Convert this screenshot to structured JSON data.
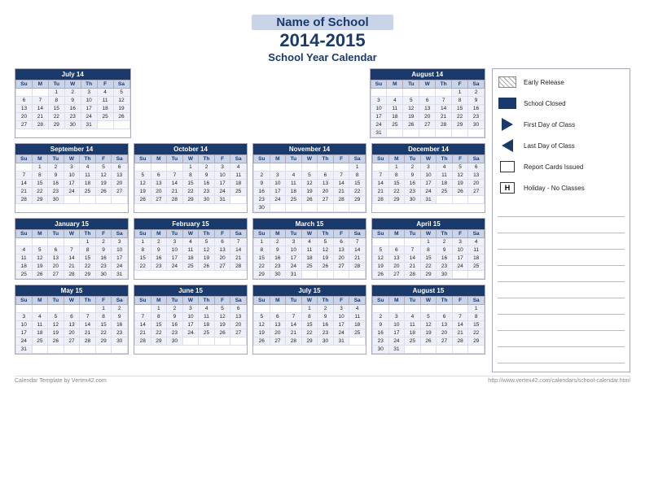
{
  "header": {
    "school_name": "Name of School",
    "year": "2014-2015",
    "subtitle": "School Year Calendar"
  },
  "legend": {
    "items": [
      {
        "id": "early-release",
        "label": "Early Release",
        "icon": "hatch"
      },
      {
        "id": "school-closed",
        "label": "School Closed",
        "icon": "solid"
      },
      {
        "id": "first-day",
        "label": "First Day of Class",
        "icon": "triangle-right"
      },
      {
        "id": "last-day",
        "label": "Last Day of Class",
        "icon": "triangle-left"
      },
      {
        "id": "report-cards",
        "label": "Report Cards Issued",
        "icon": "outline-box"
      },
      {
        "id": "holiday",
        "label": "Holiday - No Classes",
        "icon": "h-box"
      }
    ]
  },
  "footer": {
    "left": "Calendar Template by Vertex42.com",
    "right": "http://www.vertex42.com/calendars/school-calendar.html"
  },
  "months": [
    {
      "name": "July 14",
      "headers": [
        "Su",
        "M",
        "Tu",
        "W",
        "Th",
        "F",
        "Sa"
      ],
      "rows": [
        [
          "",
          "",
          "1",
          "2",
          "3",
          "4",
          "5"
        ],
        [
          "6",
          "7",
          "8",
          "9",
          "10",
          "11",
          "12"
        ],
        [
          "13",
          "14",
          "15",
          "16",
          "17",
          "18",
          "19"
        ],
        [
          "20",
          "21",
          "22",
          "23",
          "24",
          "25",
          "26"
        ],
        [
          "27",
          "28",
          "29",
          "30",
          "31",
          "",
          ""
        ]
      ]
    },
    {
      "name": "August 14",
      "headers": [
        "Su",
        "M",
        "Tu",
        "W",
        "Th",
        "F",
        "Sa"
      ],
      "rows": [
        [
          "",
          "",
          "",
          "",
          "",
          "1",
          "2"
        ],
        [
          "3",
          "4",
          "5",
          "6",
          "7",
          "8",
          "9"
        ],
        [
          "10",
          "11",
          "12",
          "13",
          "14",
          "15",
          "16"
        ],
        [
          "17",
          "18",
          "19",
          "20",
          "21",
          "22",
          "23"
        ],
        [
          "24",
          "25",
          "26",
          "27",
          "28",
          "29",
          "30"
        ],
        [
          "31",
          "",
          "",
          "",
          "",
          "",
          ""
        ]
      ]
    },
    {
      "name": "September 14",
      "headers": [
        "Su",
        "M",
        "Tu",
        "W",
        "Th",
        "F",
        "Sa"
      ],
      "rows": [
        [
          "",
          "1",
          "2",
          "3",
          "4",
          "5",
          "6"
        ],
        [
          "7",
          "8",
          "9",
          "10",
          "11",
          "12",
          "13"
        ],
        [
          "14",
          "15",
          "16",
          "17",
          "18",
          "19",
          "20"
        ],
        [
          "21",
          "22",
          "23",
          "24",
          "25",
          "26",
          "27"
        ],
        [
          "28",
          "29",
          "30",
          "",
          "",
          "",
          ""
        ]
      ]
    },
    {
      "name": "October 14",
      "headers": [
        "Su",
        "M",
        "Tu",
        "W",
        "Th",
        "F",
        "Sa"
      ],
      "rows": [
        [
          "",
          "",
          "",
          "1",
          "2",
          "3",
          "4"
        ],
        [
          "5",
          "6",
          "7",
          "8",
          "9",
          "10",
          "11"
        ],
        [
          "12",
          "13",
          "14",
          "15",
          "16",
          "17",
          "18"
        ],
        [
          "19",
          "20",
          "21",
          "22",
          "23",
          "24",
          "25"
        ],
        [
          "26",
          "27",
          "28",
          "29",
          "30",
          "31",
          ""
        ]
      ]
    },
    {
      "name": "November 14",
      "headers": [
        "Su",
        "M",
        "Tu",
        "W",
        "Th",
        "F",
        "Sa"
      ],
      "rows": [
        [
          "",
          "",
          "",
          "",
          "",
          "",
          "1"
        ],
        [
          "2",
          "3",
          "4",
          "5",
          "6",
          "7",
          "8"
        ],
        [
          "9",
          "10",
          "11",
          "12",
          "13",
          "14",
          "15"
        ],
        [
          "16",
          "17",
          "18",
          "19",
          "20",
          "21",
          "22"
        ],
        [
          "23",
          "24",
          "25",
          "26",
          "27",
          "28",
          "29"
        ],
        [
          "30",
          "",
          "",
          "",
          "",
          "",
          ""
        ]
      ]
    },
    {
      "name": "December 14",
      "headers": [
        "Su",
        "M",
        "Tu",
        "W",
        "Th",
        "F",
        "Sa"
      ],
      "rows": [
        [
          "",
          "1",
          "2",
          "3",
          "4",
          "5",
          "6"
        ],
        [
          "7",
          "8",
          "9",
          "10",
          "11",
          "12",
          "13"
        ],
        [
          "14",
          "15",
          "16",
          "17",
          "18",
          "19",
          "20"
        ],
        [
          "21",
          "22",
          "23",
          "24",
          "25",
          "26",
          "27"
        ],
        [
          "28",
          "29",
          "30",
          "31",
          "",
          "",
          ""
        ]
      ]
    },
    {
      "name": "January 15",
      "headers": [
        "Su",
        "M",
        "Tu",
        "W",
        "Th",
        "F",
        "Sa"
      ],
      "rows": [
        [
          "",
          "",
          "",
          "",
          "1",
          "2",
          "3"
        ],
        [
          "4",
          "5",
          "6",
          "7",
          "8",
          "9",
          "10"
        ],
        [
          "11",
          "12",
          "13",
          "14",
          "15",
          "16",
          "17"
        ],
        [
          "18",
          "19",
          "20",
          "21",
          "22",
          "23",
          "24"
        ],
        [
          "25",
          "26",
          "27",
          "28",
          "29",
          "30",
          "31"
        ]
      ]
    },
    {
      "name": "February 15",
      "headers": [
        "Su",
        "M",
        "Tu",
        "W",
        "Th",
        "F",
        "Sa"
      ],
      "rows": [
        [
          "1",
          "2",
          "3",
          "4",
          "5",
          "6",
          "7"
        ],
        [
          "8",
          "9",
          "10",
          "11",
          "12",
          "13",
          "14"
        ],
        [
          "15",
          "16",
          "17",
          "18",
          "19",
          "20",
          "21"
        ],
        [
          "22",
          "23",
          "24",
          "25",
          "26",
          "27",
          "28"
        ]
      ]
    },
    {
      "name": "March 15",
      "headers": [
        "Su",
        "M",
        "Tu",
        "W",
        "Th",
        "F",
        "Sa"
      ],
      "rows": [
        [
          "1",
          "2",
          "3",
          "4",
          "5",
          "6",
          "7"
        ],
        [
          "8",
          "9",
          "10",
          "11",
          "12",
          "13",
          "14"
        ],
        [
          "15",
          "16",
          "17",
          "18",
          "19",
          "20",
          "21"
        ],
        [
          "22",
          "23",
          "24",
          "25",
          "26",
          "27",
          "28"
        ],
        [
          "29",
          "30",
          "31",
          "",
          "",
          "",
          ""
        ]
      ]
    },
    {
      "name": "April 15",
      "headers": [
        "Su",
        "M",
        "Tu",
        "W",
        "Th",
        "F",
        "Sa"
      ],
      "rows": [
        [
          "",
          "",
          "",
          "1",
          "2",
          "3",
          "4"
        ],
        [
          "5",
          "6",
          "7",
          "8",
          "9",
          "10",
          "11"
        ],
        [
          "12",
          "13",
          "14",
          "15",
          "16",
          "17",
          "18"
        ],
        [
          "19",
          "20",
          "21",
          "22",
          "23",
          "24",
          "25"
        ],
        [
          "26",
          "27",
          "28",
          "29",
          "30",
          "",
          ""
        ]
      ]
    },
    {
      "name": "May 15",
      "headers": [
        "Su",
        "M",
        "Tu",
        "W",
        "Th",
        "F",
        "Sa"
      ],
      "rows": [
        [
          "",
          "",
          "",
          "",
          "",
          "1",
          "2"
        ],
        [
          "3",
          "4",
          "5",
          "6",
          "7",
          "8",
          "9"
        ],
        [
          "10",
          "11",
          "12",
          "13",
          "14",
          "15",
          "16"
        ],
        [
          "17",
          "18",
          "19",
          "20",
          "21",
          "22",
          "23"
        ],
        [
          "24",
          "25",
          "26",
          "27",
          "28",
          "29",
          "30"
        ],
        [
          "31",
          "",
          "",
          "",
          "",
          "",
          ""
        ]
      ]
    },
    {
      "name": "June 15",
      "headers": [
        "Su",
        "M",
        "Tu",
        "W",
        "Th",
        "F",
        "Sa"
      ],
      "rows": [
        [
          "",
          "1",
          "2",
          "3",
          "4",
          "5",
          "6"
        ],
        [
          "7",
          "8",
          "9",
          "10",
          "11",
          "12",
          "13"
        ],
        [
          "14",
          "15",
          "16",
          "17",
          "18",
          "19",
          "20"
        ],
        [
          "21",
          "22",
          "23",
          "24",
          "25",
          "26",
          "27"
        ],
        [
          "28",
          "29",
          "30",
          "",
          "",
          "",
          ""
        ]
      ]
    },
    {
      "name": "July 15",
      "headers": [
        "Su",
        "M",
        "Tu",
        "W",
        "Th",
        "F",
        "Sa"
      ],
      "rows": [
        [
          "",
          "",
          "",
          "1",
          "2",
          "3",
          "4"
        ],
        [
          "5",
          "6",
          "7",
          "8",
          "9",
          "10",
          "11"
        ],
        [
          "12",
          "13",
          "14",
          "15",
          "16",
          "17",
          "18"
        ],
        [
          "19",
          "20",
          "21",
          "22",
          "23",
          "24",
          "25"
        ],
        [
          "26",
          "27",
          "28",
          "29",
          "30",
          "31",
          ""
        ]
      ]
    },
    {
      "name": "August 15",
      "headers": [
        "Su",
        "M",
        "Tu",
        "W",
        "Th",
        "F",
        "Sa"
      ],
      "rows": [
        [
          "",
          "",
          "",
          "",
          "",
          "",
          "1"
        ],
        [
          "2",
          "3",
          "4",
          "5",
          "6",
          "7",
          "8"
        ],
        [
          "9",
          "10",
          "11",
          "12",
          "13",
          "14",
          "15"
        ],
        [
          "16",
          "17",
          "18",
          "19",
          "20",
          "21",
          "22"
        ],
        [
          "23",
          "24",
          "25",
          "26",
          "27",
          "28",
          "29"
        ],
        [
          "30",
          "31",
          "",
          "",
          "",
          "",
          ""
        ]
      ]
    }
  ]
}
